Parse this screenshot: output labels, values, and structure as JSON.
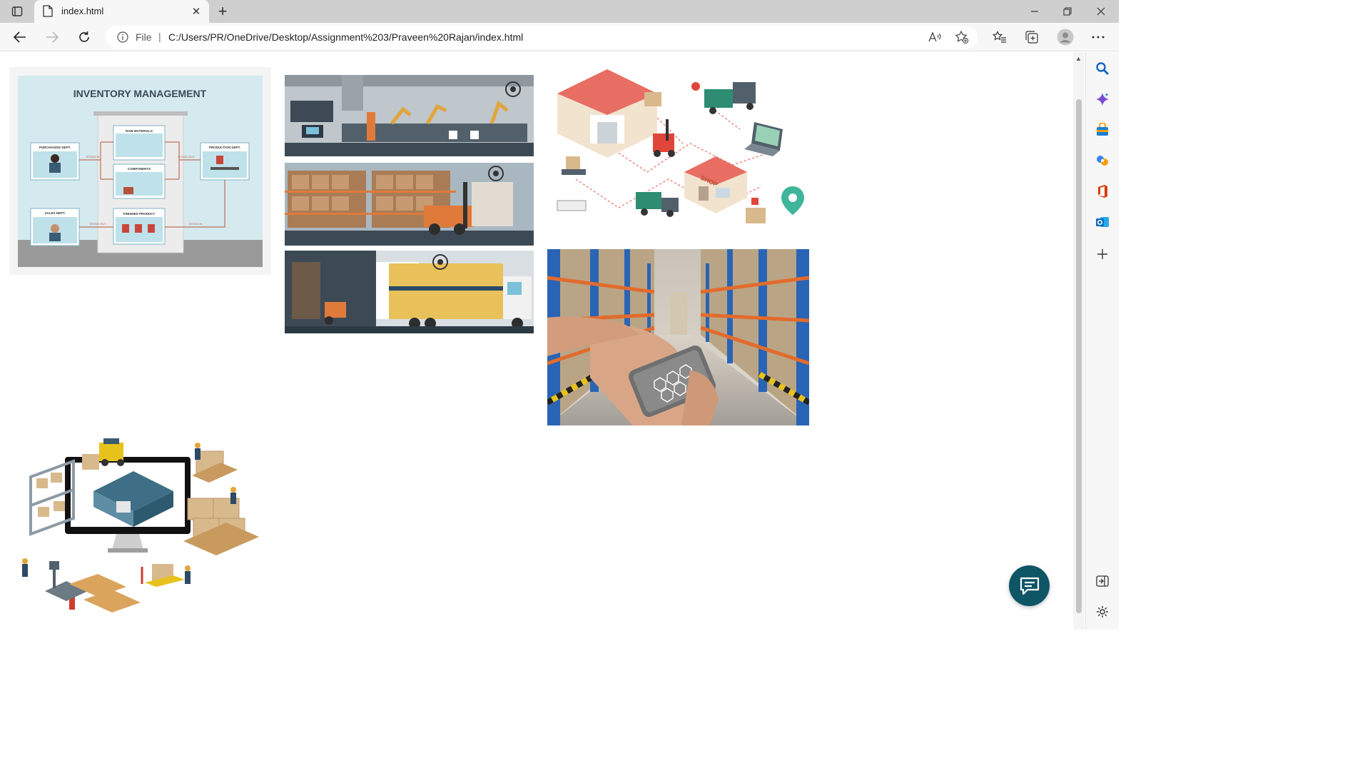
{
  "tab": {
    "title": "index.html"
  },
  "address_bar": {
    "scheme_label": "File",
    "separator": "|",
    "url": "C:/Users/PR/OneDrive/Desktop/Assignment%203/Praveen%20Rajan/index.html"
  },
  "page": {
    "images": [
      {
        "subject": "inventory-management-flowchart",
        "title_text": "INVENTORY MANAGEMENT",
        "labels": [
          "PURCHASING DEPT.",
          "RAW MATERIALS",
          "PRODUCTION DEPT.",
          "COMPONENTS",
          "SALES DEPT.",
          "FINISHED PRODUCT",
          "STOCK IN",
          "STOCK OUT",
          "STOCK OUT",
          "STOCK IN"
        ]
      },
      {
        "subject": "factory-warehouse-truck-iot-illustration"
      },
      {
        "subject": "isometric-supply-chain-network",
        "shop_sign": "SHOP"
      },
      {
        "subject": "hand-holding-phone-in-warehouse-aisle-photo"
      },
      {
        "subject": "isometric-warehouse-monitor-illustration"
      }
    ]
  },
  "colors": {
    "titlebar": "#cfcfcf",
    "toolbar": "#f7f7f7",
    "chat_button": "#0e5566",
    "copilot_accent": "#7b4bd6",
    "office_red": "#d83b01",
    "outlook_blue": "#0f6cbd"
  }
}
